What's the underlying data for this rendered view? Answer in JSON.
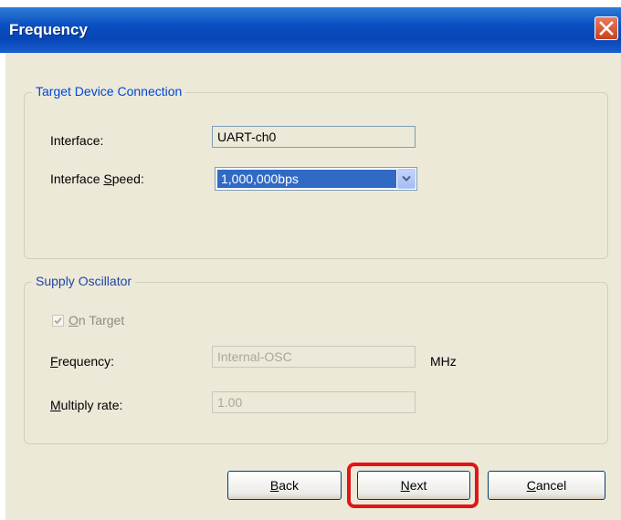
{
  "window": {
    "title": "Frequency"
  },
  "target_group": {
    "title": "Target Device Connection",
    "interface_label": "Interface:",
    "interface_value": "UART-ch0",
    "speed_label_pre": "Interface ",
    "speed_label_mnemonic": "S",
    "speed_label_post": "peed:",
    "speed_value": "1,000,000bps"
  },
  "oscillator_group": {
    "title": "Supply Oscillator",
    "on_target_mnemonic": "O",
    "on_target_rest": "n Target",
    "on_target_checked": true,
    "frequency_mnemonic": "F",
    "frequency_rest": "requency:",
    "frequency_value": "Internal-OSC",
    "frequency_unit": "MHz",
    "multiply_mnemonic": "M",
    "multiply_rest": "ultiply rate:",
    "multiply_value": "1.00"
  },
  "buttons": {
    "back_mnemonic": "B",
    "back_rest": "ack",
    "next_mnemonic": "N",
    "next_rest": "ext",
    "cancel_mnemonic": "C",
    "cancel_rest": "ancel"
  },
  "colors": {
    "titlebar": "#0a4fc2",
    "highlight": "#e11515",
    "selection": "#316ac5"
  }
}
